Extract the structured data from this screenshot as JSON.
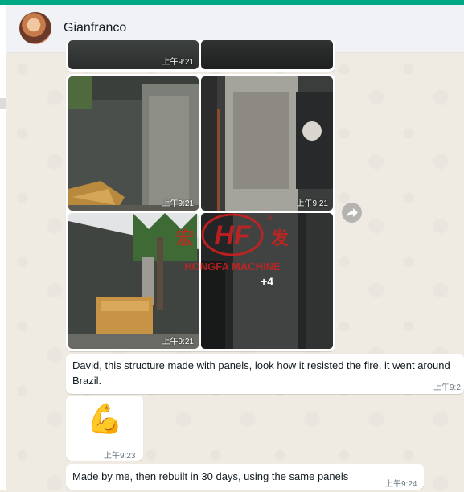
{
  "header": {
    "contact_name": "Gianfranco",
    "avatar_icon": "avatar-photo"
  },
  "colors": {
    "accent": "#00a884",
    "chat_bg": "#efeae2",
    "bubble": "#ffffff"
  },
  "album_top": {
    "times": [
      "上午9:21"
    ]
  },
  "album": {
    "tiles": [
      {
        "time": "上午9:21",
        "overlay": ""
      },
      {
        "time": "上午9:21",
        "overlay": ""
      },
      {
        "time": "上午9:21",
        "overlay": ""
      },
      {
        "time": "",
        "overlay": "+4"
      }
    ]
  },
  "watermark": {
    "brand": "HF",
    "left_char": "宏",
    "right_char": "发",
    "caption": "HONGFA MACHINE",
    "registered": "®"
  },
  "messages": [
    {
      "text": "David, this structure made with panels, look how it resisted the fire, it went around Brazil.",
      "time": "上午9:2"
    },
    {
      "emoji": "💪",
      "time": "上午9:23"
    },
    {
      "text": "Made by me, then rebuilt in 30 days, using the same panels",
      "time": "上午9:24"
    }
  ]
}
